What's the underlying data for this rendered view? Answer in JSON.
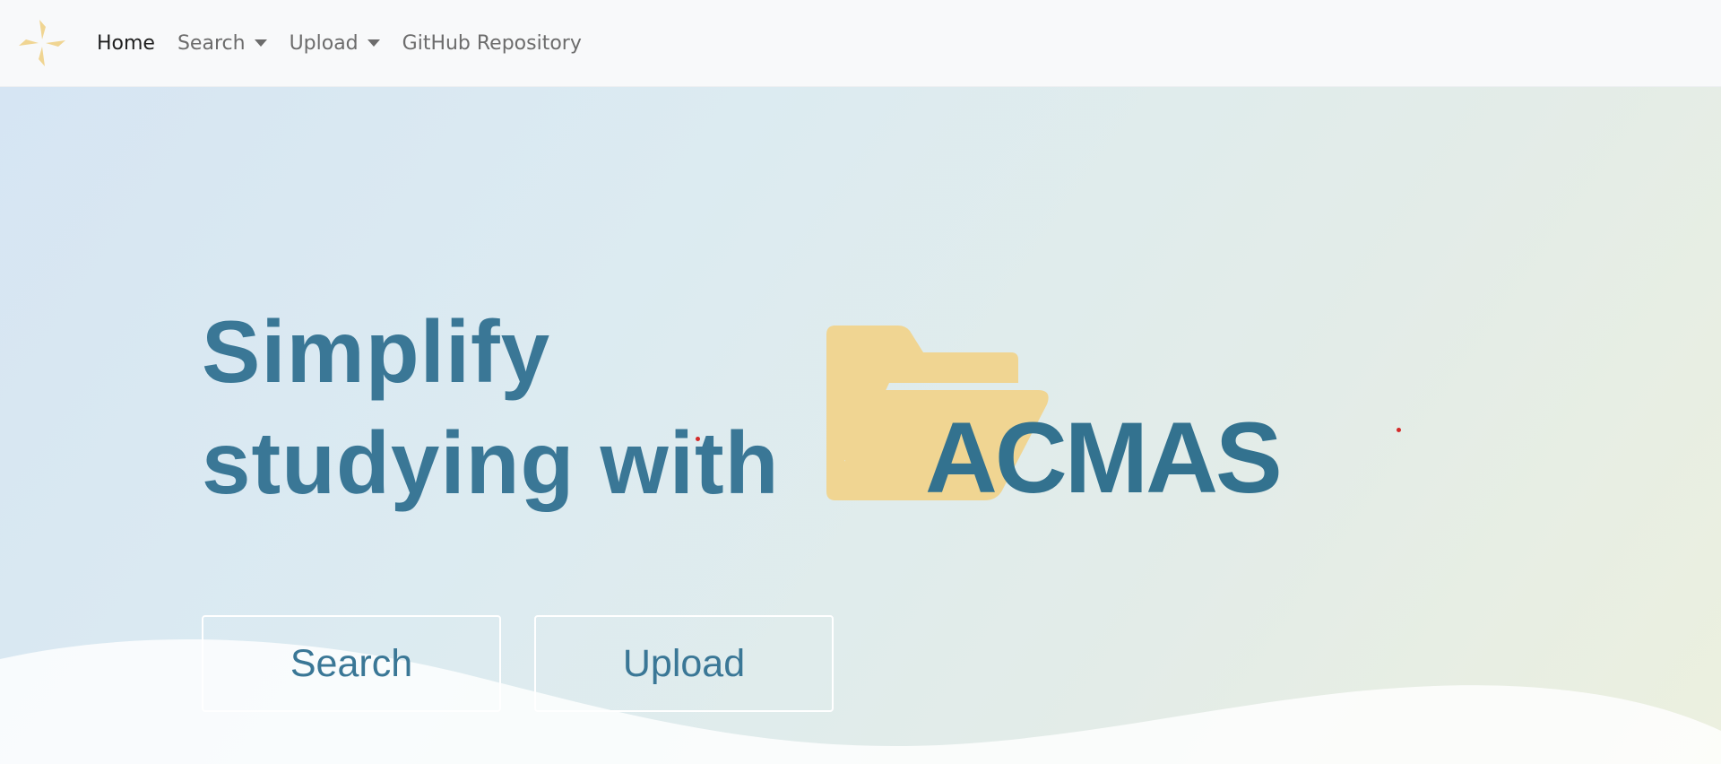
{
  "navbar": {
    "brand_icon": "pinwheel-logo-icon",
    "items": [
      {
        "label": "Home",
        "active": true,
        "dropdown": false
      },
      {
        "label": "Search",
        "active": false,
        "dropdown": true
      },
      {
        "label": "Upload",
        "active": false,
        "dropdown": true
      },
      {
        "label": "GitHub Repository",
        "active": false,
        "dropdown": false
      }
    ]
  },
  "hero": {
    "headline_line1": "Simplify",
    "headline_line2": "studying with",
    "logo_text": "ACMAS",
    "logo_icon": "folder-icon",
    "buttons": {
      "search_label": "Search",
      "upload_label": "Upload"
    }
  },
  "colors": {
    "accent": "#3a7796",
    "brand_yellow": "#f0d592",
    "nav_bg": "#f8f9fa"
  }
}
